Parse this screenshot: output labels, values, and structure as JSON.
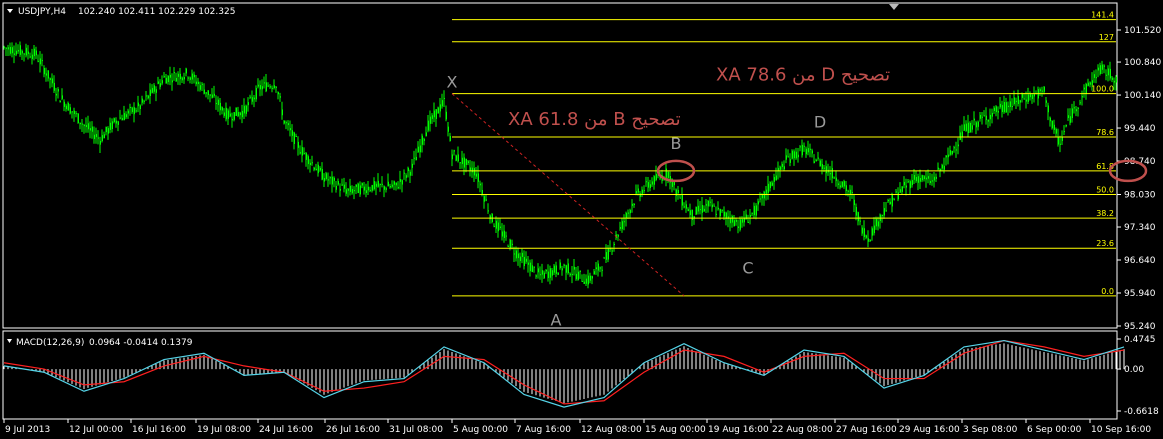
{
  "header": {
    "symbol_label": "USDJPY,H4",
    "quote": "102.240 102.411 102.229 102.325"
  },
  "macd_header": {
    "label": "MACD(12,26,9)",
    "values": "0.0964 -0.0414 0.1379"
  },
  "colors": {
    "background": "#000000",
    "candle": "#00ff00",
    "fib_line": "#ffff00",
    "xa_line": "#cc2222",
    "annotation": "#c0504d",
    "macd_line": "#55d4e8",
    "signal_line": "#ff2020",
    "histogram": "#ffffff",
    "grid": "#ffffff"
  },
  "chart_data": [
    {
      "type": "candlestick",
      "title": "USDJPY,H4",
      "y_ticks": [
        "101.520",
        "100.840",
        "100.140",
        "99.440",
        "98.740",
        "98.030",
        "97.340",
        "96.640",
        "95.940",
        "95.240"
      ],
      "ylim": [
        95.24,
        101.52
      ],
      "x_ticks": [
        "9 Jul 2013",
        "12 Jul 00:00",
        "16 Jul 16:00",
        "19 Jul 08:00",
        "24 Jul 16:00",
        "26 Jul 16:00",
        "31 Jul 08:00",
        "5 Aug 00:00",
        "7 Aug 16:00",
        "12 Aug 08:00",
        "15 Aug 00:00",
        "19 Aug 16:00",
        "22 Aug 08:00",
        "27 Aug 16:00",
        "29 Aug 16:00",
        "3 Sep 08:00",
        "6 Sep 00:00",
        "10 Sep 16:00"
      ],
      "price_path": [
        [
          0,
          101.15
        ],
        [
          4,
          101.0
        ],
        [
          7,
          100.1
        ],
        [
          10,
          99.5
        ],
        [
          12,
          99.2
        ],
        [
          14,
          99.6
        ],
        [
          17,
          99.9
        ],
        [
          20,
          100.5
        ],
        [
          23,
          100.6
        ],
        [
          26,
          100.1
        ],
        [
          28,
          99.7
        ],
        [
          30,
          99.8
        ],
        [
          32,
          100.3
        ],
        [
          34,
          100.4
        ],
        [
          35,
          99.6
        ],
        [
          37,
          99.0
        ],
        [
          40,
          98.4
        ],
        [
          43,
          98.1
        ],
        [
          46,
          98.2
        ],
        [
          49,
          98.2
        ],
        [
          51,
          98.6
        ],
        [
          53,
          99.5
        ],
        [
          55,
          100.0
        ],
        [
          56,
          98.9
        ],
        [
          59,
          98.5
        ],
        [
          61,
          97.5
        ],
        [
          64,
          96.8
        ],
        [
          67,
          96.3
        ],
        [
          70,
          96.5
        ],
        [
          73,
          96.2
        ],
        [
          75,
          96.6
        ],
        [
          77,
          97.3
        ],
        [
          79,
          98.0
        ],
        [
          81,
          98.3
        ],
        [
          83,
          98.5
        ],
        [
          84,
          98.1
        ],
        [
          86,
          97.6
        ],
        [
          88,
          97.8
        ],
        [
          90,
          97.6
        ],
        [
          92,
          97.4
        ],
        [
          94,
          97.7
        ],
        [
          96,
          98.3
        ],
        [
          98,
          98.8
        ],
        [
          100,
          99.0
        ],
        [
          102,
          98.7
        ],
        [
          104,
          98.4
        ],
        [
          106,
          98.0
        ],
        [
          107,
          97.4
        ],
        [
          108,
          97.1
        ],
        [
          110,
          97.7
        ],
        [
          112,
          98.1
        ],
        [
          114,
          98.4
        ],
        [
          116,
          98.3
        ],
        [
          118,
          98.8
        ],
        [
          120,
          99.4
        ],
        [
          122,
          99.6
        ],
        [
          124,
          99.8
        ],
        [
          126,
          99.95
        ],
        [
          128,
          100.1
        ],
        [
          130,
          100.2
        ],
        [
          131,
          99.5
        ],
        [
          132,
          99.1
        ],
        [
          133,
          99.6
        ],
        [
          134,
          99.9
        ],
        [
          135,
          100.2
        ],
        [
          137,
          100.7
        ],
        [
          139,
          100.5
        ]
      ],
      "fibonacci_levels": [
        {
          "label": "141.4",
          "price": 101.74
        },
        {
          "label": "127",
          "price": 101.27
        },
        {
          "label": "100.0",
          "price": 100.17
        },
        {
          "label": "78.6",
          "price": 99.25
        },
        {
          "label": "61.8",
          "price": 98.53
        },
        {
          "label": "50.0",
          "price": 98.03
        },
        {
          "label": "38.2",
          "price": 97.53
        },
        {
          "label": "23.6",
          "price": 96.89
        },
        {
          "label": "0.0",
          "price": 95.88
        }
      ],
      "fib_bars": [
        56,
        139
      ],
      "xa_line": {
        "from": {
          "bar": 56,
          "price": 100.17
        },
        "to": {
          "bar": 85,
          "price": 95.88
        }
      },
      "points": [
        {
          "label": "X",
          "bar": 56,
          "price": 100.3
        },
        {
          "label": "A",
          "bar": 69,
          "price": 95.25
        },
        {
          "label": "B",
          "bar": 84,
          "price": 99.0
        },
        {
          "label": "C",
          "bar": 93,
          "price": 96.35
        },
        {
          "label": "D",
          "bar": 102,
          "price": 99.45
        }
      ],
      "annotations": [
        {
          "text": "XA 78.6 من D تصحيح",
          "bar": 89,
          "price": 100.45
        },
        {
          "text": "XA 61.8 من B تصحيح",
          "bar": 63,
          "price": 99.5
        }
      ],
      "highlight_ellipses": [
        {
          "bar": 84,
          "price": 98.53,
          "note": "B"
        },
        {
          "bar": 140.5,
          "price": 98.53,
          "note": "61.8"
        }
      ]
    },
    {
      "type": "line",
      "title": "MACD(12,26,9)",
      "y_ticks": [
        "0.4745",
        "0.00",
        "-0.6618"
      ],
      "ylim": [
        -0.6618,
        0.4745
      ],
      "x": [
        0,
        5,
        10,
        15,
        20,
        25,
        30,
        35,
        40,
        45,
        50,
        55,
        60,
        65,
        70,
        75,
        80,
        85,
        90,
        95,
        100,
        105,
        110,
        115,
        120,
        125,
        130,
        135,
        140
      ],
      "series": [
        {
          "name": "MACD",
          "values": [
            0.05,
            -0.05,
            -0.35,
            -0.15,
            0.15,
            0.25,
            -0.1,
            -0.05,
            -0.45,
            -0.2,
            -0.15,
            0.35,
            0.1,
            -0.4,
            -0.6,
            -0.45,
            0.1,
            0.4,
            0.1,
            -0.1,
            0.3,
            0.2,
            -0.3,
            -0.1,
            0.35,
            0.45,
            0.3,
            0.15,
            0.35
          ]
        },
        {
          "name": "Signal",
          "values": [
            0.1,
            0.0,
            -0.25,
            -0.2,
            0.05,
            0.2,
            0.05,
            -0.05,
            -0.35,
            -0.3,
            -0.2,
            0.2,
            0.15,
            -0.25,
            -0.55,
            -0.5,
            -0.05,
            0.3,
            0.2,
            -0.05,
            0.2,
            0.25,
            -0.15,
            -0.15,
            0.25,
            0.45,
            0.35,
            0.2,
            0.3
          ]
        }
      ]
    }
  ]
}
